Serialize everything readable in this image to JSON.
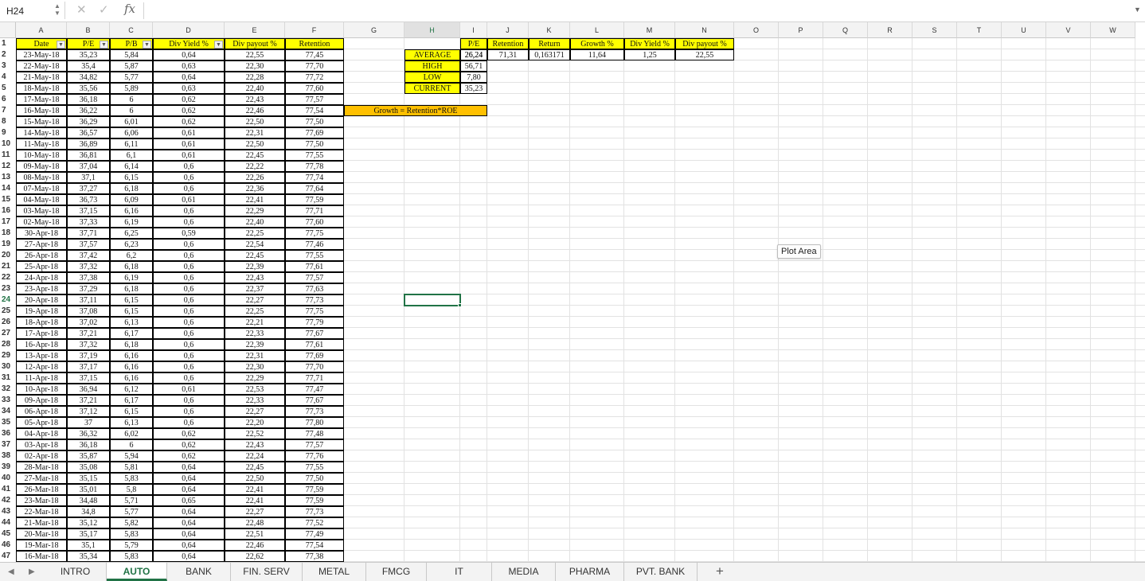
{
  "formula_bar": {
    "cell_ref": "H24",
    "cancel_glyph": "✕",
    "enter_glyph": "✓",
    "fx_label": "fx",
    "value": ""
  },
  "columns": [
    "A",
    "B",
    "C",
    "D",
    "E",
    "F",
    "G",
    "H",
    "I",
    "J",
    "K",
    "L",
    "M",
    "N",
    "O",
    "P",
    "Q",
    "R",
    "S",
    "T",
    "U",
    "V",
    "W"
  ],
  "selected_cell": "H24",
  "table": {
    "headers": [
      "Date",
      "P/E",
      "P/B",
      "Div Yield %",
      "Div payout %",
      "Retention"
    ],
    "rows": [
      [
        "23-May-18",
        "35,23",
        "5,84",
        "0,64",
        "22,55",
        "77,45"
      ],
      [
        "22-May-18",
        "35,4",
        "5,87",
        "0,63",
        "22,30",
        "77,70"
      ],
      [
        "21-May-18",
        "34,82",
        "5,77",
        "0,64",
        "22,28",
        "77,72"
      ],
      [
        "18-May-18",
        "35,56",
        "5,89",
        "0,63",
        "22,40",
        "77,60"
      ],
      [
        "17-May-18",
        "36,18",
        "6",
        "0,62",
        "22,43",
        "77,57"
      ],
      [
        "16-May-18",
        "36,22",
        "6",
        "0,62",
        "22,46",
        "77,54"
      ],
      [
        "15-May-18",
        "36,29",
        "6,01",
        "0,62",
        "22,50",
        "77,50"
      ],
      [
        "14-May-18",
        "36,57",
        "6,06",
        "0,61",
        "22,31",
        "77,69"
      ],
      [
        "11-May-18",
        "36,89",
        "6,11",
        "0,61",
        "22,50",
        "77,50"
      ],
      [
        "10-May-18",
        "36,81",
        "6,1",
        "0,61",
        "22,45",
        "77,55"
      ],
      [
        "09-May-18",
        "37,04",
        "6,14",
        "0,6",
        "22,22",
        "77,78"
      ],
      [
        "08-May-18",
        "37,1",
        "6,15",
        "0,6",
        "22,26",
        "77,74"
      ],
      [
        "07-May-18",
        "37,27",
        "6,18",
        "0,6",
        "22,36",
        "77,64"
      ],
      [
        "04-May-18",
        "36,73",
        "6,09",
        "0,61",
        "22,41",
        "77,59"
      ],
      [
        "03-May-18",
        "37,15",
        "6,16",
        "0,6",
        "22,29",
        "77,71"
      ],
      [
        "02-May-18",
        "37,33",
        "6,19",
        "0,6",
        "22,40",
        "77,60"
      ],
      [
        "30-Apr-18",
        "37,71",
        "6,25",
        "0,59",
        "22,25",
        "77,75"
      ],
      [
        "27-Apr-18",
        "37,57",
        "6,23",
        "0,6",
        "22,54",
        "77,46"
      ],
      [
        "26-Apr-18",
        "37,42",
        "6,2",
        "0,6",
        "22,45",
        "77,55"
      ],
      [
        "25-Apr-18",
        "37,32",
        "6,18",
        "0,6",
        "22,39",
        "77,61"
      ],
      [
        "24-Apr-18",
        "37,38",
        "6,19",
        "0,6",
        "22,43",
        "77,57"
      ],
      [
        "23-Apr-18",
        "37,29",
        "6,18",
        "0,6",
        "22,37",
        "77,63"
      ],
      [
        "20-Apr-18",
        "37,11",
        "6,15",
        "0,6",
        "22,27",
        "77,73"
      ],
      [
        "19-Apr-18",
        "37,08",
        "6,15",
        "0,6",
        "22,25",
        "77,75"
      ],
      [
        "18-Apr-18",
        "37,02",
        "6,13",
        "0,6",
        "22,21",
        "77,79"
      ],
      [
        "17-Apr-18",
        "37,21",
        "6,17",
        "0,6",
        "22,33",
        "77,67"
      ],
      [
        "16-Apr-18",
        "37,32",
        "6,18",
        "0,6",
        "22,39",
        "77,61"
      ],
      [
        "13-Apr-18",
        "37,19",
        "6,16",
        "0,6",
        "22,31",
        "77,69"
      ],
      [
        "12-Apr-18",
        "37,17",
        "6,16",
        "0,6",
        "22,30",
        "77,70"
      ],
      [
        "11-Apr-18",
        "37,15",
        "6,16",
        "0,6",
        "22,29",
        "77,71"
      ],
      [
        "10-Apr-18",
        "36,94",
        "6,12",
        "0,61",
        "22,53",
        "77,47"
      ],
      [
        "09-Apr-18",
        "37,21",
        "6,17",
        "0,6",
        "22,33",
        "77,67"
      ],
      [
        "06-Apr-18",
        "37,12",
        "6,15",
        "0,6",
        "22,27",
        "77,73"
      ],
      [
        "05-Apr-18",
        "37",
        "6,13",
        "0,6",
        "22,20",
        "77,80"
      ],
      [
        "04-Apr-18",
        "36,32",
        "6,02",
        "0,62",
        "22,52",
        "77,48"
      ],
      [
        "03-Apr-18",
        "36,18",
        "6",
        "0,62",
        "22,43",
        "77,57"
      ],
      [
        "02-Apr-18",
        "35,87",
        "5,94",
        "0,62",
        "22,24",
        "77,76"
      ],
      [
        "28-Mar-18",
        "35,08",
        "5,81",
        "0,64",
        "22,45",
        "77,55"
      ],
      [
        "27-Mar-18",
        "35,15",
        "5,83",
        "0,64",
        "22,50",
        "77,50"
      ],
      [
        "26-Mar-18",
        "35,01",
        "5,8",
        "0,64",
        "22,41",
        "77,59"
      ],
      [
        "23-Mar-18",
        "34,48",
        "5,71",
        "0,65",
        "22,41",
        "77,59"
      ],
      [
        "22-Mar-18",
        "34,8",
        "5,77",
        "0,64",
        "22,27",
        "77,73"
      ],
      [
        "21-Mar-18",
        "35,12",
        "5,82",
        "0,64",
        "22,48",
        "77,52"
      ],
      [
        "20-Mar-18",
        "35,17",
        "5,83",
        "0,64",
        "22,51",
        "77,49"
      ],
      [
        "19-Mar-18",
        "35,1",
        "5,79",
        "0,64",
        "22,46",
        "77,54"
      ],
      [
        "16-Mar-18",
        "35,34",
        "5,83",
        "0,64",
        "22,62",
        "77,38"
      ]
    ]
  },
  "stats": {
    "rows": [
      {
        "label": "AVERAGE",
        "value": "26,24"
      },
      {
        "label": "HIGH",
        "value": "56,71"
      },
      {
        "label": "LOW",
        "value": "7,80"
      },
      {
        "label": "CURRENT",
        "value": "35,23"
      }
    ]
  },
  "summary": {
    "headers": [
      "P/E",
      "Retention",
      "Return",
      "Growth %",
      "Div Yield %",
      "Div payout %"
    ],
    "values": [
      "26,24",
      "71,31",
      "0,163171",
      "11,64",
      "1,25",
      "22,55"
    ]
  },
  "formula_note": "Growth = Retention*ROE",
  "tooltip": "Plot Area",
  "sheet_tabs": [
    "INTRO",
    "AUTO",
    "BANK",
    "FIN. SERV",
    "METAL",
    "FMCG",
    "IT",
    "MEDIA",
    "PHARMA",
    "PVT. BANK"
  ],
  "active_tab": "AUTO",
  "colors": {
    "accent": "#217346",
    "header_yellow": "#ffff00",
    "note_orange": "#ffc000"
  }
}
